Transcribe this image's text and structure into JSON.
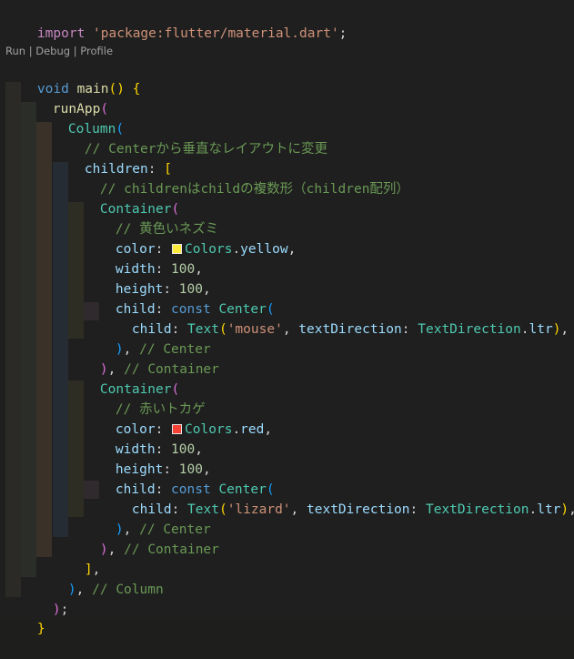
{
  "code": {
    "import_kw": "import",
    "import_path": "'package:flutter/material.dart'",
    "semicolon": ";",
    "codelens": {
      "run": "Run",
      "sep1": " | ",
      "debug": "Debug",
      "sep2": " | ",
      "profile": "Profile"
    },
    "void_kw": "void",
    "main_fn": "main",
    "run_app": "runApp",
    "column": "Column",
    "comment_center": "// Centerから垂直なレイアウトに変更",
    "children_key": "children",
    "comment_children": "// childrenはchildの複数形（children配列）",
    "container": "Container",
    "comment_mouse": "// 黄色いネズミ",
    "comment_lizard": "// 赤いトカゲ",
    "color_key": "color",
    "width_key": "width",
    "height_key": "height",
    "child_key": "child",
    "const_kw": "const",
    "center": "Center",
    "text_cls": "Text",
    "mouse_str": "'mouse'",
    "lizard_str": "'lizard'",
    "text_direction_key": "textDirection",
    "text_direction_cls": "TextDirection",
    "ltr": "ltr",
    "colors_cls": "Colors",
    "yellow": "yellow",
    "red": "red",
    "num_100": "100",
    "comment_end_center": "// Center",
    "comment_end_container": "// Container",
    "comment_end_column": "// Column",
    "yellow_hex": "#ffeb3b",
    "red_hex": "#f44336"
  }
}
